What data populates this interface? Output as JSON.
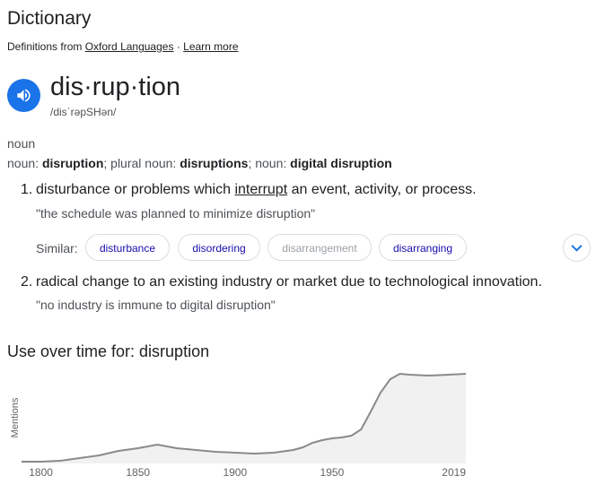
{
  "header": {
    "title": "Dictionary",
    "definitions_from_prefix": "Definitions from",
    "source_link": "Oxford Languages",
    "separator": "·",
    "learn_more": "Learn more"
  },
  "entry": {
    "headword": "dis·rup·tion",
    "phonetic": "/disˈrəpSHən/",
    "part_of_speech": "noun",
    "forms": {
      "label1": "noun: ",
      "form1": "disruption",
      "sep1": "; plural noun: ",
      "form2": "disruptions",
      "sep2": "; noun: ",
      "form3": "digital disruption"
    }
  },
  "senses": [
    {
      "number": "1.",
      "text_before": "disturbance or problems which ",
      "link": "interrupt",
      "text_after": " an event, activity, or process.",
      "example": "\"the schedule was planned to minimize disruption\""
    },
    {
      "number": "2.",
      "text": "radical change to an existing industry or market due to technological innovation.",
      "example": "\"no industry is immune to digital disruption\""
    }
  ],
  "similar": {
    "label": "Similar:",
    "chips": [
      {
        "label": "disturbance",
        "enabled": true
      },
      {
        "label": "disordering",
        "enabled": true
      },
      {
        "label": "disarrangement",
        "enabled": false
      },
      {
        "label": "disarranging",
        "enabled": true
      }
    ],
    "expand_icon": "chevron-down-icon"
  },
  "usage": {
    "title": "Use over time for: disruption"
  },
  "chart_data": {
    "type": "area",
    "title": "",
    "xlabel": "",
    "ylabel": "Mentions",
    "x_ticks": [
      "1800",
      "1850",
      "1900",
      "1950",
      "2019"
    ],
    "xlim": [
      1790,
      2019
    ],
    "ylim": [
      0,
      100
    ],
    "grid": false,
    "line_color": "#8a8a8a",
    "fill_color": "#f1f1f1",
    "x": [
      1790,
      1800,
      1810,
      1820,
      1830,
      1840,
      1850,
      1855,
      1860,
      1865,
      1870,
      1880,
      1890,
      1900,
      1910,
      1920,
      1930,
      1935,
      1940,
      1945,
      1950,
      1955,
      1960,
      1965,
      1970,
      1975,
      1980,
      1985,
      1990,
      2000,
      2010,
      2019
    ],
    "values": [
      2,
      2,
      3,
      6,
      9,
      14,
      17,
      19,
      21,
      19,
      17,
      15,
      13,
      12,
      11,
      12,
      15,
      18,
      23,
      26,
      28,
      29,
      31,
      38,
      58,
      79,
      94,
      100,
      99,
      98,
      99,
      100
    ]
  }
}
